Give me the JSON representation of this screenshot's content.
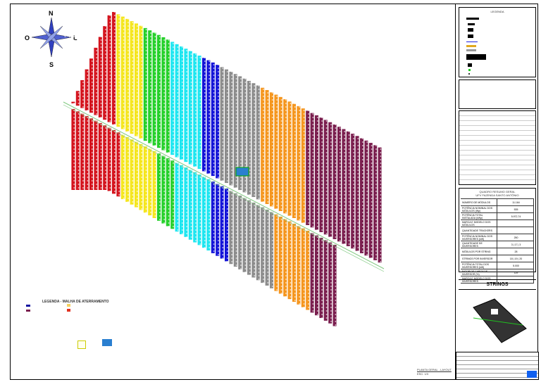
{
  "compass": {
    "n": "N",
    "s": "S",
    "w": "O",
    "e": "L"
  },
  "legend_title": "LEGENDA",
  "legend_grounding_title": "LEGENDA - MALHA DE ATERRAMENTO",
  "summary": {
    "title": "QUADRO RESUMO GERAL",
    "subtitle": "UFV FAZENDA SANTO ANTÔNIO",
    "rows": [
      [
        "NÚMERO DE MÓDULOS",
        "11.164"
      ],
      [
        "POTÊNCIA NOMINAL DOS MÓDULOS (Wp)",
        "535"
      ],
      [
        "POTÊNCIA TOTAL INSTALADA (kWp)",
        "5.972,74"
      ],
      [
        "MARCA E MODELO DOS MÓDULOS",
        ""
      ],
      [
        "QUANTIDADE TRACKERS",
        ""
      ],
      [
        "POTÊNCIA NOMINAL DOS INVERSORES (kW)",
        "250"
      ],
      [
        "QUANTIDADE DE INVERSORES",
        "3 | 17 | 3"
      ],
      [
        "MÓDULOS POR STRING",
        "28"
      ],
      [
        "STRINGS POR INVERSOR",
        "18 | 19 | 20"
      ],
      [
        "POTÊNCIA TOTAL DOS INVERSORES (kW)",
        "5.000"
      ],
      [
        "FATOR DE CARGA DE INVERSOR (%)",
        "119"
      ],
      [
        "MARCA E MODELO DOS INVERSORES",
        ""
      ]
    ]
  },
  "strings_title": "STRINGS",
  "plan_label": "PLANTA GERAL - LAYOUT",
  "scale_label": "ESC: 1/X",
  "colors": [
    "#d4141e",
    "#f5e61e",
    "#25d02a",
    "#1ee6f0",
    "#1414d8",
    "#8c8c8c",
    "#f5961e",
    "#7a1e4e"
  ]
}
